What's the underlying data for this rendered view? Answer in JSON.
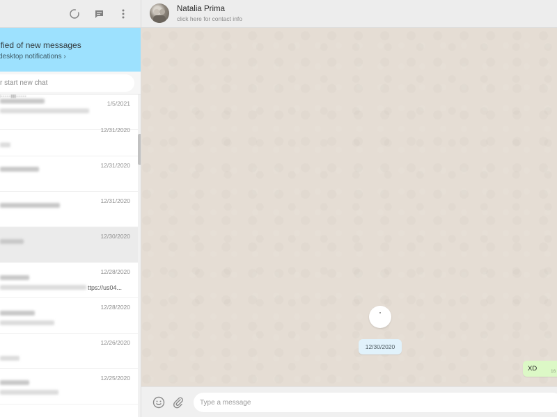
{
  "sidebar": {
    "header_icons": [
      "status-icon",
      "new-chat-icon",
      "menu-icon"
    ],
    "notification": {
      "title": "ified of new messages",
      "link": "desktop notifications ›"
    },
    "search": {
      "placeholder": "r start new chat"
    },
    "chats": [
      {
        "name_fragment": "...",
        "date": "1/5/2021",
        "snippet": ""
      },
      {
        "date": "12/31/2020",
        "snippet": ""
      },
      {
        "date": "12/31/2020",
        "snippet": ""
      },
      {
        "date": "12/31/2020",
        "snippet": ""
      },
      {
        "date": "12/30/2020",
        "snippet": "",
        "selected": true
      },
      {
        "date": "12/28/2020",
        "snippet": "ttps://us04..."
      },
      {
        "date": "12/28/2020",
        "snippet": ""
      },
      {
        "date": "12/26/2020",
        "snippet": ""
      },
      {
        "date": "12/25/2020",
        "snippet": ""
      }
    ]
  },
  "conversation": {
    "contact_name": "Natalia Prima",
    "contact_subtitle": "click here for contact info",
    "date_chip": "12/30/2020",
    "messages": [
      {
        "direction": "outgoing",
        "text": "XD",
        "time": "16"
      }
    ],
    "composer": {
      "placeholder": "Type a message",
      "icons": [
        "emoji-icon",
        "attach-icon"
      ]
    }
  },
  "colors": {
    "notification_bg": "#9de1fe",
    "chat_bg": "#e5ddd4",
    "outgoing_bubble": "#dcf8c6",
    "date_chip_bg": "#e1f2fb"
  }
}
